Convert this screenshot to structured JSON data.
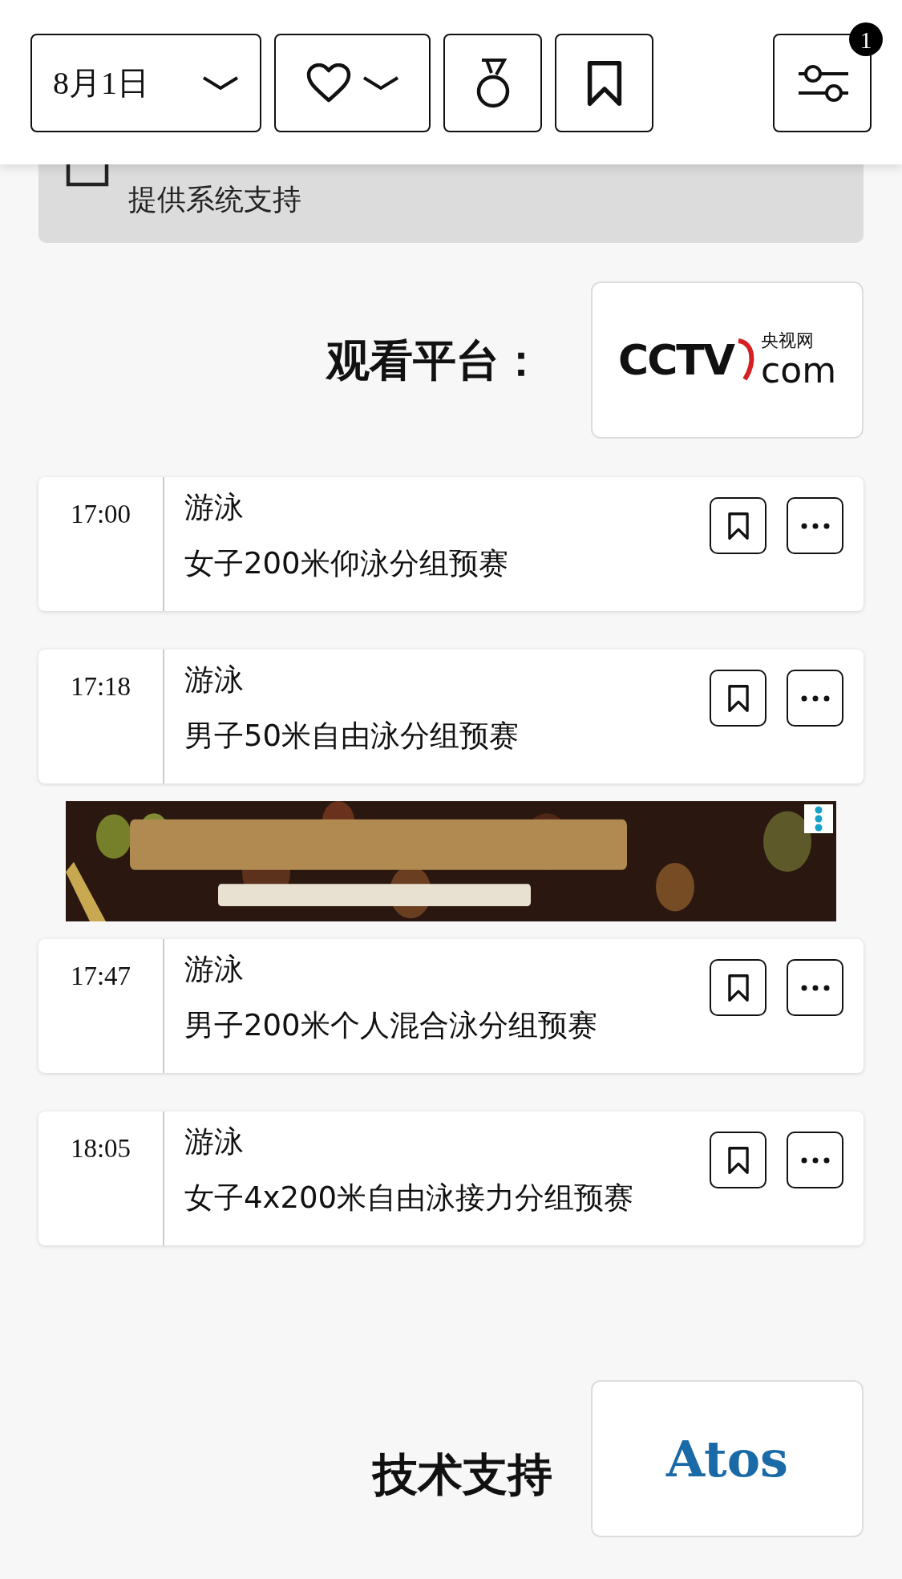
{
  "toolbar": {
    "date_label": "8月1日",
    "filter_badge": "1"
  },
  "notice": {
    "text": "提供系统支持"
  },
  "platform": {
    "label": "观看平台：",
    "logo": {
      "wordmark": "CCTV",
      "chinese": "央视网",
      "suffix": "com"
    }
  },
  "items": [
    {
      "kind": "event",
      "time": "17:00",
      "sport": "游泳",
      "event": "女子200米仰泳分组预赛"
    },
    {
      "kind": "event",
      "time": "17:18",
      "sport": "游泳",
      "event": "男子50米自由泳分组预赛"
    },
    {
      "kind": "ad"
    },
    {
      "kind": "event",
      "time": "17:47",
      "sport": "游泳",
      "event": "男子200米个人混合泳分组预赛"
    },
    {
      "kind": "event",
      "time": "18:05",
      "sport": "游泳",
      "event": "女子4x200米自由泳接力分组预赛"
    }
  ],
  "tech_support": {
    "label": "技术支持",
    "logo": "Atos"
  }
}
